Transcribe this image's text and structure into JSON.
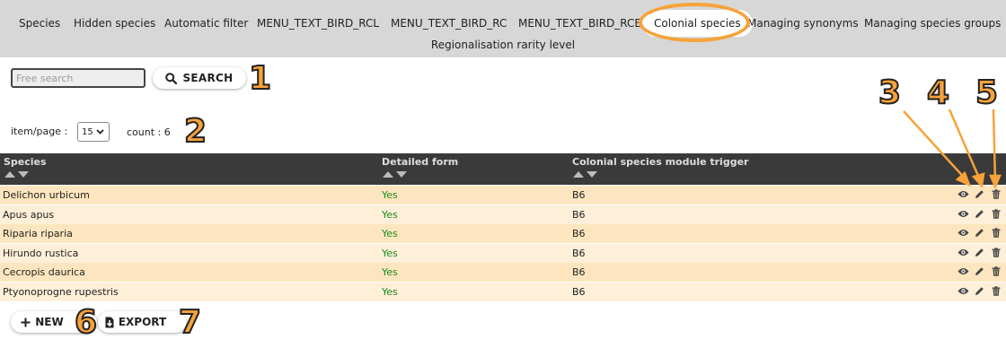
{
  "nav": {
    "tabs": [
      {
        "label": "Species",
        "active": false
      },
      {
        "label": "Hidden species",
        "active": false
      },
      {
        "label": "Automatic filter",
        "active": false
      },
      {
        "label": "MENU_TEXT_BIRD_RCL",
        "active": false
      },
      {
        "label": "MENU_TEXT_BIRD_RC",
        "active": false
      },
      {
        "label": "MENU_TEXT_BIRD_RCE",
        "active": false
      },
      {
        "label": "Colonial species",
        "active": true
      },
      {
        "label": "Managing synonyms",
        "active": false
      },
      {
        "label": "Managing species groups",
        "active": false
      }
    ],
    "sub_tab": "Regionalisation rarity level"
  },
  "search": {
    "placeholder": "Free search",
    "value": "",
    "button_label": "SEARCH",
    "icon": "search-icon"
  },
  "pagination": {
    "items_label": "item/page :",
    "items_value": "15",
    "count_label": "count : 6"
  },
  "table": {
    "columns": [
      "Species",
      "Detailed form",
      "Colonial species module trigger"
    ],
    "rows": [
      {
        "species": "Delichon urbicum",
        "detailed": "Yes",
        "trigger": "B6"
      },
      {
        "species": "Apus apus",
        "detailed": "Yes",
        "trigger": "B6"
      },
      {
        "species": "Riparia riparia",
        "detailed": "Yes",
        "trigger": "B6"
      },
      {
        "species": "Hirundo rustica",
        "detailed": "Yes",
        "trigger": "B6"
      },
      {
        "species": "Cecropis daurica",
        "detailed": "Yes",
        "trigger": "B6"
      },
      {
        "species": "Ptyonoprogne rupestris",
        "detailed": "Yes",
        "trigger": "B6"
      }
    ],
    "row_actions": [
      "eye-icon",
      "pencil-icon",
      "trash-icon"
    ]
  },
  "buttons": {
    "new_label": "NEW",
    "export_label": "EXPORT"
  },
  "callouts": [
    "1",
    "2",
    "3",
    "4",
    "5",
    "6",
    "7"
  ],
  "colors": {
    "nav_bg": "#d7d7d7",
    "header_bg": "#3a3a3a",
    "row_odd": "#fde6bf",
    "row_even": "#feefd8",
    "callout": "#f7a23a",
    "yes_text": "#1a8c1a"
  }
}
